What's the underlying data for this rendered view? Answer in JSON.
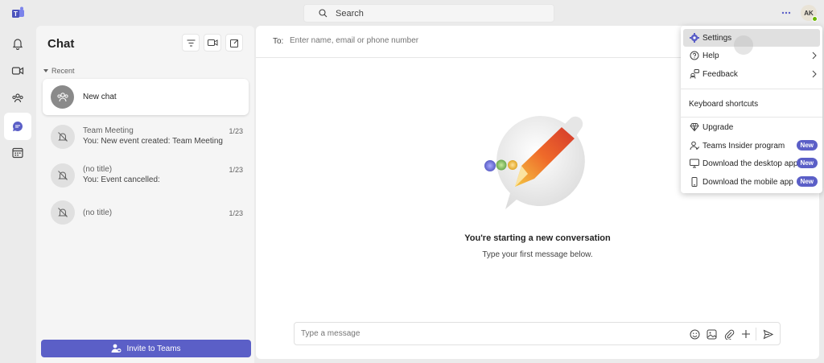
{
  "search": {
    "placeholder": "Search"
  },
  "user": {
    "initials": "AK"
  },
  "chat_panel": {
    "title": "Chat",
    "section_label": "Recent",
    "new_chat_label": "New chat",
    "items": [
      {
        "name": "Team Meeting",
        "preview": "You: New event created: Team Meeting",
        "date": "1/23"
      },
      {
        "name": "(no title)",
        "preview": "You: Event cancelled:",
        "date": "1/23"
      },
      {
        "name": "(no title)",
        "preview": "",
        "date": "1/23"
      }
    ],
    "invite_label": "Invite to Teams"
  },
  "main": {
    "to_label": "To:",
    "to_placeholder": "Enter name, email or phone number",
    "start_title": "You're starting a new conversation",
    "start_subtitle": "Type your first message below.",
    "compose_placeholder": "Type a message"
  },
  "menu": {
    "settings": "Settings",
    "help": "Help",
    "feedback": "Feedback",
    "keyboard_shortcuts": "Keyboard shortcuts",
    "upgrade": "Upgrade",
    "insider": "Teams Insider program",
    "desktop_app": "Download the desktop app",
    "mobile_app": "Download the mobile app",
    "new_badge": "New"
  },
  "colors": {
    "brand": "#5b5fc7",
    "presence": "#6bb700"
  }
}
